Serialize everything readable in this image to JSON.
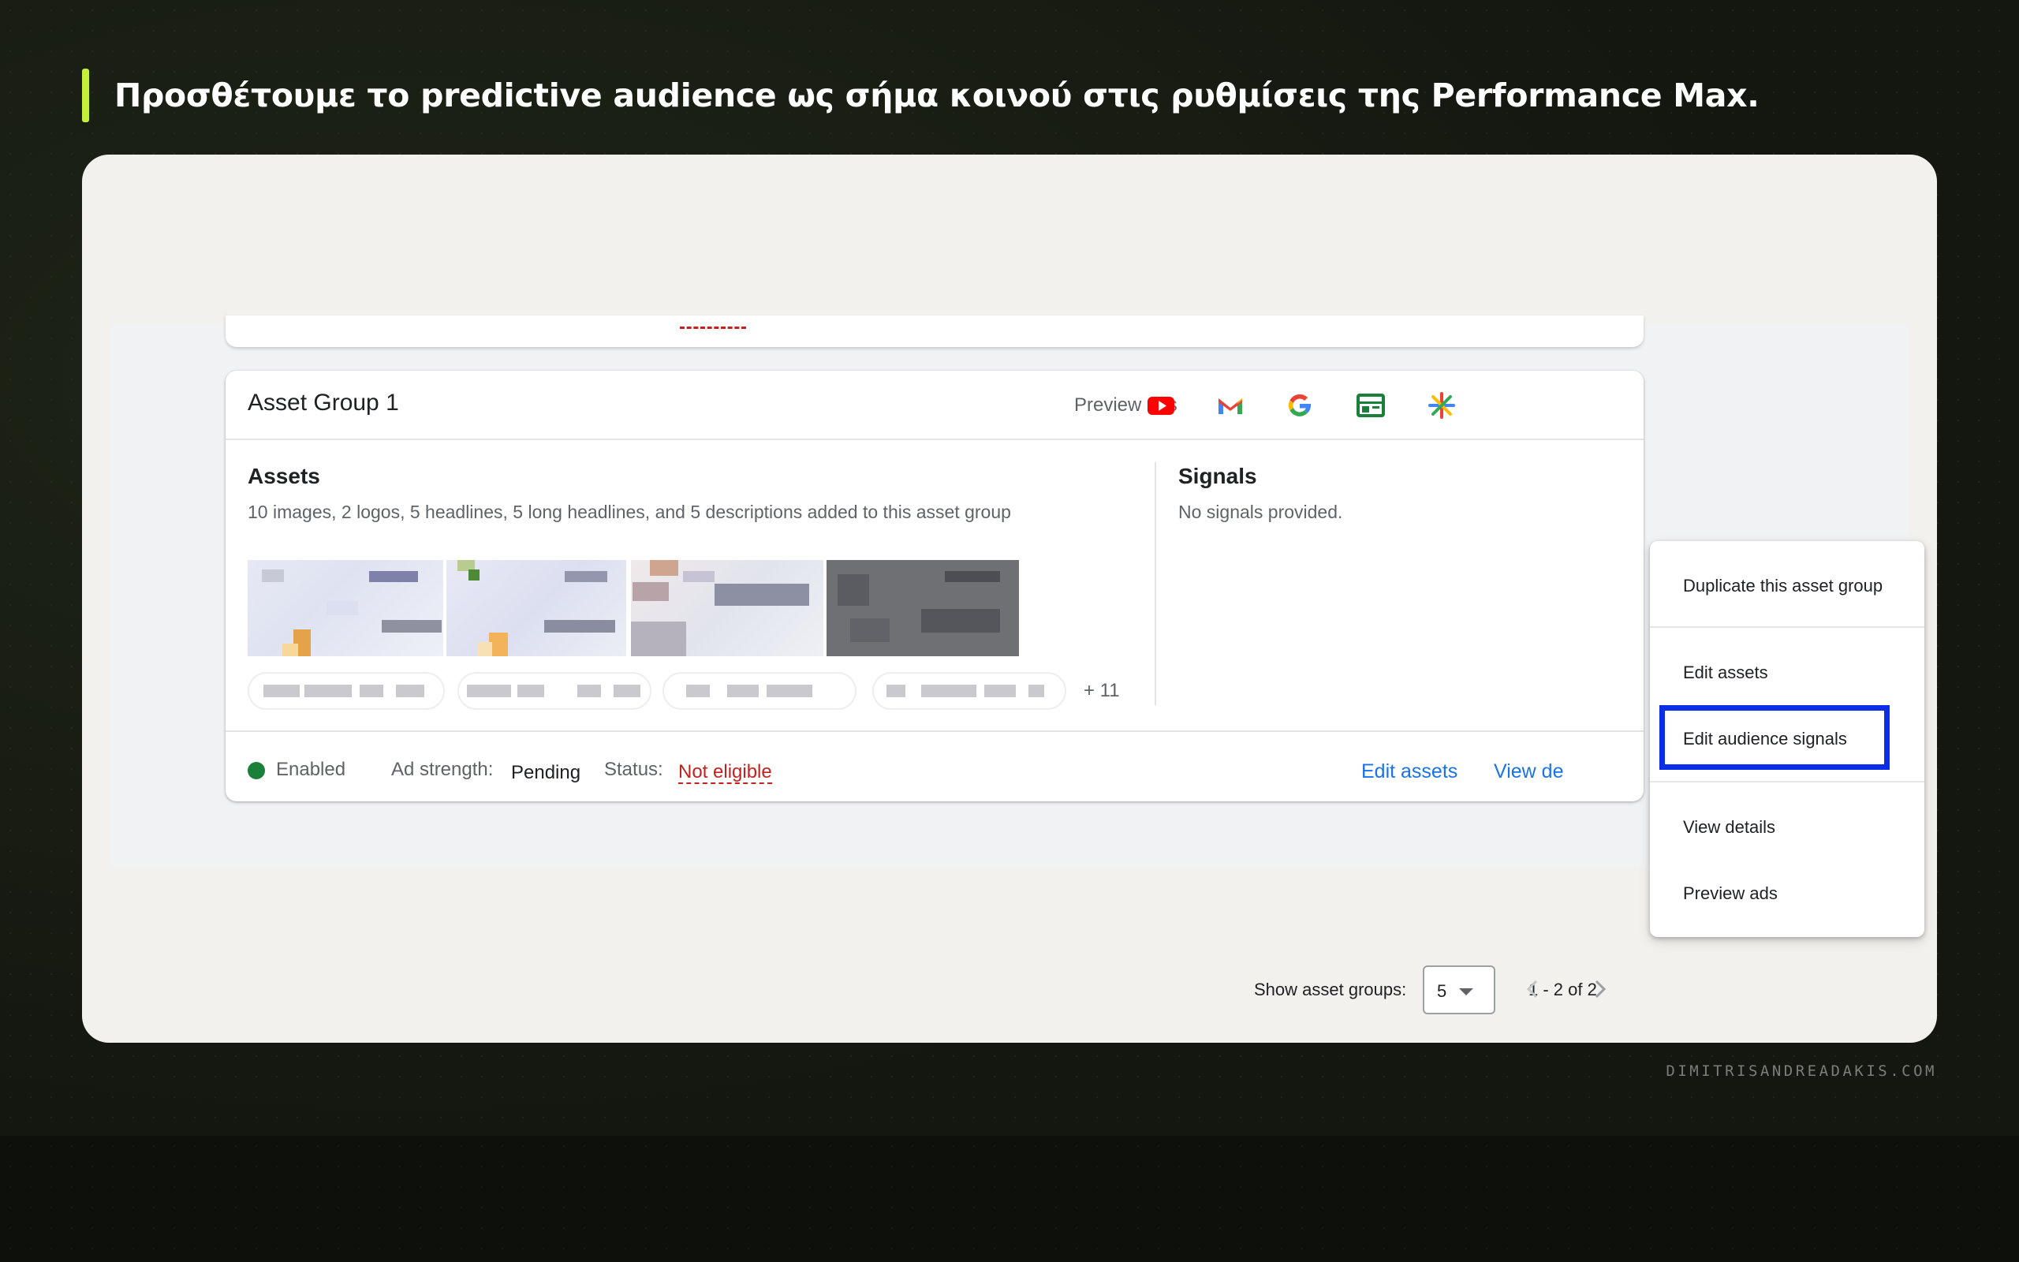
{
  "slide": {
    "heading": "Προσθέτουμε το predictive audience ως σήμα κοινού στις ρυθμίσεις της Performance Max.",
    "brand": "DIMITRISANDREADAKIS.COM"
  },
  "asset_group": {
    "title": "Asset Group 1",
    "preview_ads_label": "Preview ads",
    "network_icons": [
      "youtube-icon",
      "gmail-icon",
      "google-icon",
      "display-icon",
      "discover-icon"
    ],
    "assets": {
      "title": "Assets",
      "description": "10 images, 2 logos, 5 headlines, 5 long headlines, and 5 descriptions added to this asset group",
      "more_count": "+ 11"
    },
    "signals": {
      "title": "Signals",
      "description": "No signals provided."
    },
    "footer": {
      "status": "Enabled",
      "ad_strength_label": "Ad strength:",
      "ad_strength_value": "Pending",
      "status_label": "Status:",
      "status_value": "Not eligible",
      "edit_assets_link": "Edit assets",
      "view_details_link": "View de"
    }
  },
  "context_menu": {
    "items": [
      {
        "label": "Duplicate this asset group"
      },
      {
        "label": "Edit assets"
      },
      {
        "label": "Edit audience signals"
      },
      {
        "label": "View details"
      },
      {
        "label": "Preview ads"
      }
    ],
    "highlighted": "Edit audience signals",
    "highlight_color": "#0a2ee8"
  },
  "pagination": {
    "show_label": "Show asset groups:",
    "page_size": "5",
    "range": "1 - 2 of 2"
  },
  "colors": {
    "accent_bar": "#c6ef3a",
    "link": "#1a73e8",
    "enabled": "#188038",
    "error": "#c5221f"
  }
}
